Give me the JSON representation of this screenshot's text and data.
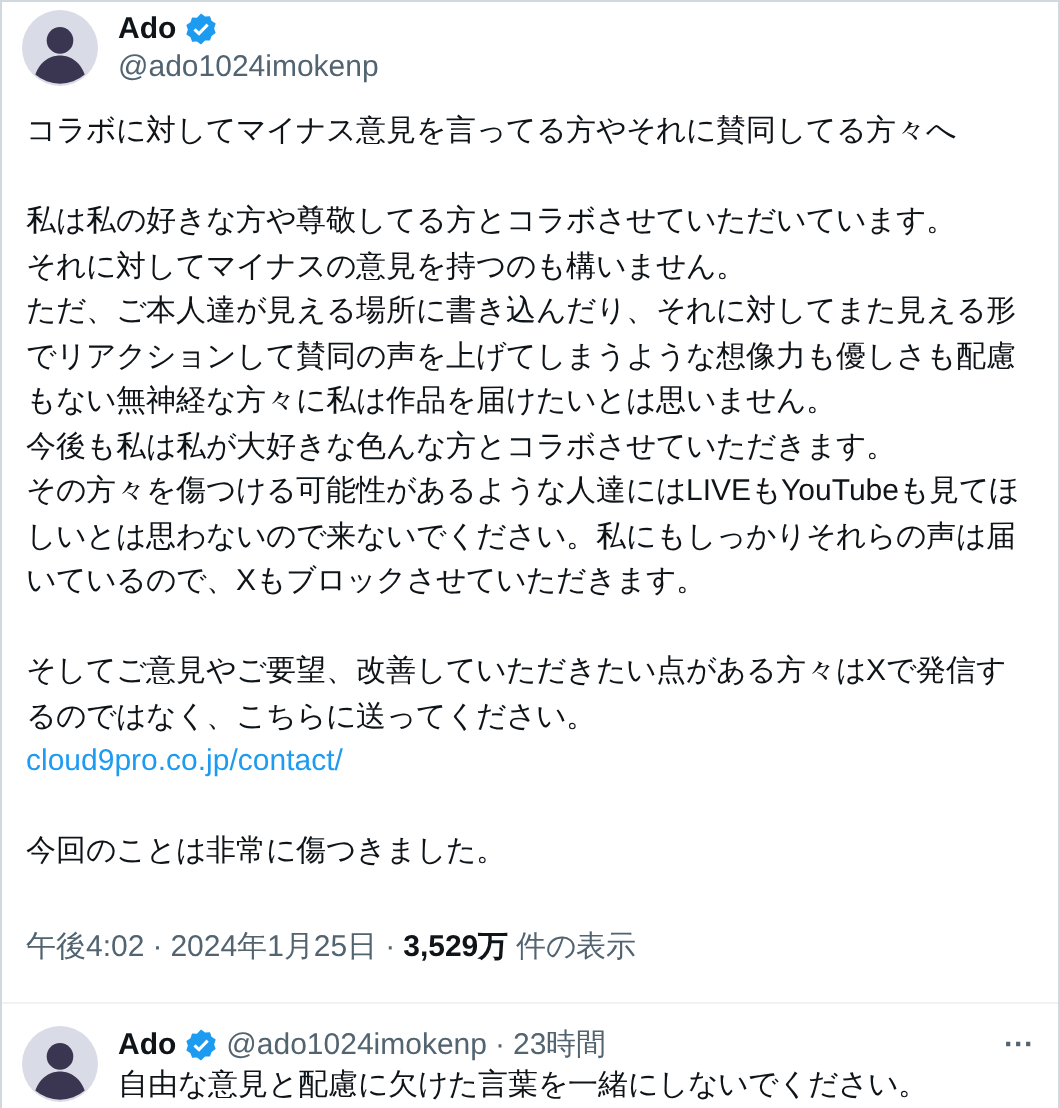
{
  "tweet": {
    "author": {
      "name": "Ado",
      "verified": true,
      "handle": "@ado1024imokenp"
    },
    "paragraphs": [
      {
        "lines": [
          "コラボに対してマイナス意見を言ってる方やそれに賛同してる方々へ"
        ]
      },
      {
        "lines": [
          "私は私の好きな方や尊敬してる方とコラボさせていただいています。",
          "それに対してマイナスの意見を持つのも構いません。",
          "ただ、ご本人達が見える場所に書き込んだり、それに対してまた見える形",
          "でリアクションして賛同の声を上げてしまうような想像力も優しさも配慮",
          "もない無神経な方々に私は作品を届けたいとは思いません。",
          "今後も私は私が大好きな色んな方とコラボさせていただきます。",
          "その方々を傷つける可能性があるような人達にはLIVEもYouTubeも見てほ",
          "しいとは思わないので来ないでください。私にもしっかりそれらの声は届",
          "いているので、Xもブロックさせていただきます。"
        ]
      },
      {
        "lines": [
          "そしてご意見やご要望、改善していただきたい点がある方々はXで発信す",
          "るのではなく、こちらに送ってください。"
        ],
        "link": "cloud9pro.co.jp/contact/"
      },
      {
        "lines": [
          "今回のことは非常に傷つきました。"
        ]
      }
    ],
    "meta": [
      {
        "kind": "text",
        "text": "午後4:02"
      },
      {
        "kind": "sep",
        "text": "·"
      },
      {
        "kind": "text",
        "text": "2024年1月25日"
      },
      {
        "kind": "sep",
        "text": "·"
      },
      {
        "kind": "bold",
        "text": "3,529万"
      },
      {
        "kind": "text",
        "text": "件の表示"
      }
    ]
  },
  "reply": {
    "author": {
      "name": "Ado",
      "verified": true,
      "handle": "@ado1024imokenp"
    },
    "separator": "·",
    "time": "23時間",
    "text": "自由な意見と配慮に欠けた言葉を一緒にしないでください。",
    "more": "···"
  }
}
